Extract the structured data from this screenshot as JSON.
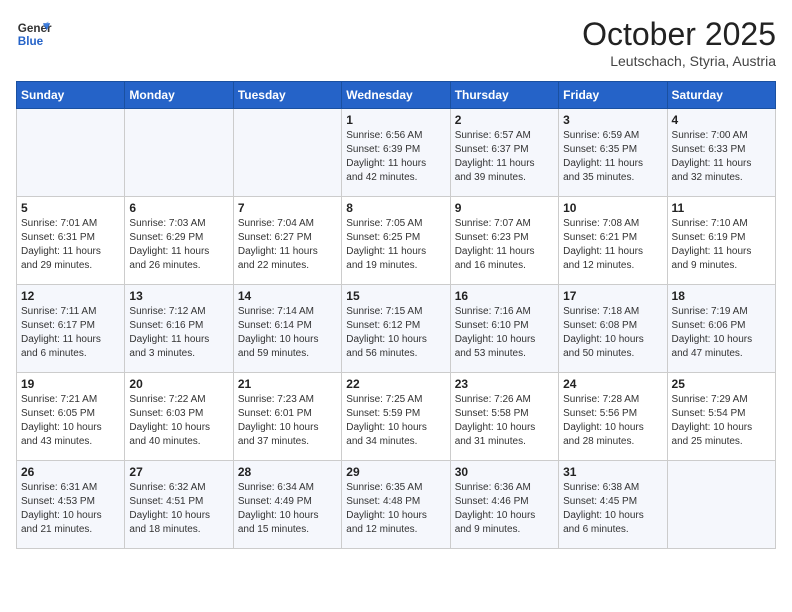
{
  "header": {
    "logo_general": "General",
    "logo_blue": "Blue",
    "month": "October 2025",
    "location": "Leutschach, Styria, Austria"
  },
  "days_of_week": [
    "Sunday",
    "Monday",
    "Tuesday",
    "Wednesday",
    "Thursday",
    "Friday",
    "Saturday"
  ],
  "weeks": [
    [
      {
        "day": "",
        "info": ""
      },
      {
        "day": "",
        "info": ""
      },
      {
        "day": "",
        "info": ""
      },
      {
        "day": "1",
        "info": "Sunrise: 6:56 AM\nSunset: 6:39 PM\nDaylight: 11 hours\nand 42 minutes."
      },
      {
        "day": "2",
        "info": "Sunrise: 6:57 AM\nSunset: 6:37 PM\nDaylight: 11 hours\nand 39 minutes."
      },
      {
        "day": "3",
        "info": "Sunrise: 6:59 AM\nSunset: 6:35 PM\nDaylight: 11 hours\nand 35 minutes."
      },
      {
        "day": "4",
        "info": "Sunrise: 7:00 AM\nSunset: 6:33 PM\nDaylight: 11 hours\nand 32 minutes."
      }
    ],
    [
      {
        "day": "5",
        "info": "Sunrise: 7:01 AM\nSunset: 6:31 PM\nDaylight: 11 hours\nand 29 minutes."
      },
      {
        "day": "6",
        "info": "Sunrise: 7:03 AM\nSunset: 6:29 PM\nDaylight: 11 hours\nand 26 minutes."
      },
      {
        "day": "7",
        "info": "Sunrise: 7:04 AM\nSunset: 6:27 PM\nDaylight: 11 hours\nand 22 minutes."
      },
      {
        "day": "8",
        "info": "Sunrise: 7:05 AM\nSunset: 6:25 PM\nDaylight: 11 hours\nand 19 minutes."
      },
      {
        "day": "9",
        "info": "Sunrise: 7:07 AM\nSunset: 6:23 PM\nDaylight: 11 hours\nand 16 minutes."
      },
      {
        "day": "10",
        "info": "Sunrise: 7:08 AM\nSunset: 6:21 PM\nDaylight: 11 hours\nand 12 minutes."
      },
      {
        "day": "11",
        "info": "Sunrise: 7:10 AM\nSunset: 6:19 PM\nDaylight: 11 hours\nand 9 minutes."
      }
    ],
    [
      {
        "day": "12",
        "info": "Sunrise: 7:11 AM\nSunset: 6:17 PM\nDaylight: 11 hours\nand 6 minutes."
      },
      {
        "day": "13",
        "info": "Sunrise: 7:12 AM\nSunset: 6:16 PM\nDaylight: 11 hours\nand 3 minutes."
      },
      {
        "day": "14",
        "info": "Sunrise: 7:14 AM\nSunset: 6:14 PM\nDaylight: 10 hours\nand 59 minutes."
      },
      {
        "day": "15",
        "info": "Sunrise: 7:15 AM\nSunset: 6:12 PM\nDaylight: 10 hours\nand 56 minutes."
      },
      {
        "day": "16",
        "info": "Sunrise: 7:16 AM\nSunset: 6:10 PM\nDaylight: 10 hours\nand 53 minutes."
      },
      {
        "day": "17",
        "info": "Sunrise: 7:18 AM\nSunset: 6:08 PM\nDaylight: 10 hours\nand 50 minutes."
      },
      {
        "day": "18",
        "info": "Sunrise: 7:19 AM\nSunset: 6:06 PM\nDaylight: 10 hours\nand 47 minutes."
      }
    ],
    [
      {
        "day": "19",
        "info": "Sunrise: 7:21 AM\nSunset: 6:05 PM\nDaylight: 10 hours\nand 43 minutes."
      },
      {
        "day": "20",
        "info": "Sunrise: 7:22 AM\nSunset: 6:03 PM\nDaylight: 10 hours\nand 40 minutes."
      },
      {
        "day": "21",
        "info": "Sunrise: 7:23 AM\nSunset: 6:01 PM\nDaylight: 10 hours\nand 37 minutes."
      },
      {
        "day": "22",
        "info": "Sunrise: 7:25 AM\nSunset: 5:59 PM\nDaylight: 10 hours\nand 34 minutes."
      },
      {
        "day": "23",
        "info": "Sunrise: 7:26 AM\nSunset: 5:58 PM\nDaylight: 10 hours\nand 31 minutes."
      },
      {
        "day": "24",
        "info": "Sunrise: 7:28 AM\nSunset: 5:56 PM\nDaylight: 10 hours\nand 28 minutes."
      },
      {
        "day": "25",
        "info": "Sunrise: 7:29 AM\nSunset: 5:54 PM\nDaylight: 10 hours\nand 25 minutes."
      }
    ],
    [
      {
        "day": "26",
        "info": "Sunrise: 6:31 AM\nSunset: 4:53 PM\nDaylight: 10 hours\nand 21 minutes."
      },
      {
        "day": "27",
        "info": "Sunrise: 6:32 AM\nSunset: 4:51 PM\nDaylight: 10 hours\nand 18 minutes."
      },
      {
        "day": "28",
        "info": "Sunrise: 6:34 AM\nSunset: 4:49 PM\nDaylight: 10 hours\nand 15 minutes."
      },
      {
        "day": "29",
        "info": "Sunrise: 6:35 AM\nSunset: 4:48 PM\nDaylight: 10 hours\nand 12 minutes."
      },
      {
        "day": "30",
        "info": "Sunrise: 6:36 AM\nSunset: 4:46 PM\nDaylight: 10 hours\nand 9 minutes."
      },
      {
        "day": "31",
        "info": "Sunrise: 6:38 AM\nSunset: 4:45 PM\nDaylight: 10 hours\nand 6 minutes."
      },
      {
        "day": "",
        "info": ""
      }
    ]
  ]
}
